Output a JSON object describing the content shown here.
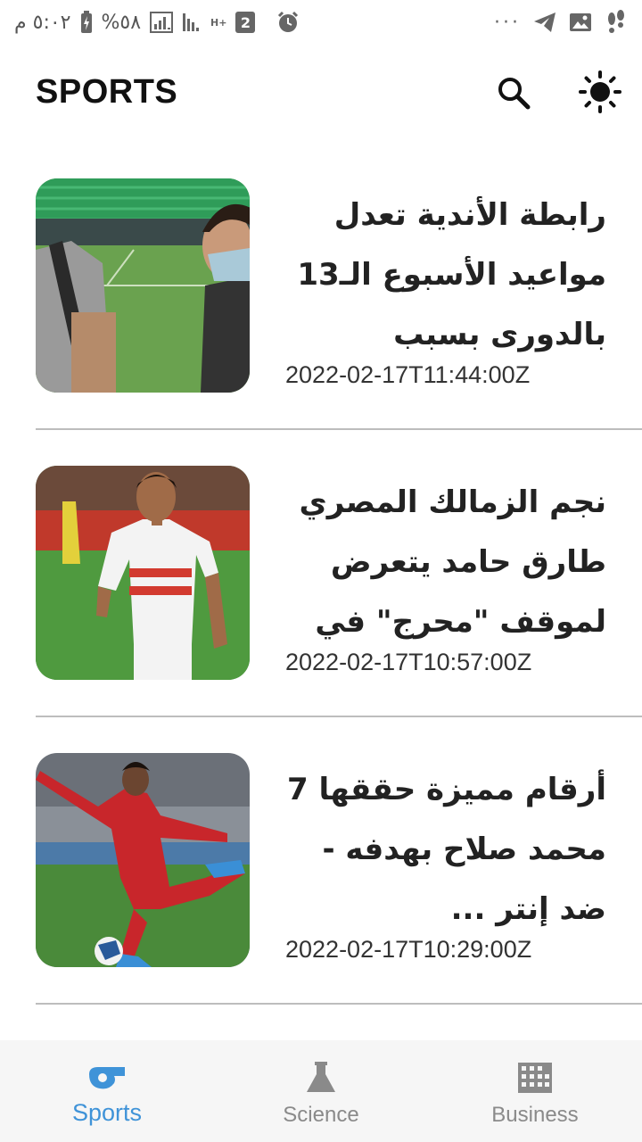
{
  "status_bar": {
    "time": "٥:٠٢ م",
    "battery": "%٥٨",
    "sim_slot": "2",
    "network": "H+",
    "more": "···"
  },
  "app_bar": {
    "title": "SPORTS",
    "search_icon": "search-icon",
    "theme_icon": "brightness-icon"
  },
  "articles": [
    {
      "headline": "رابطة الأندية تعدل مواعيد الأسبوع الـ13 بالدورى بسبب كيروش...",
      "date": "2022-02-17T11:44:00Z",
      "image": "player-with-mask-on-pitch"
    },
    {
      "headline": "نجم الزمالك المصري طارق حامد يتعرض لموقف \"محرج\" في ...",
      "date": "2022-02-17T10:57:00Z",
      "image": "zamalek-player-white-kit"
    },
    {
      "headline": "أرقام مميزة حققها 7 محمد صلاح بهدفه - ضد إنتر ...",
      "date": "2022-02-17T10:29:00Z",
      "image": "liverpool-player-kicking-ball"
    }
  ],
  "bottom_nav": {
    "items": [
      {
        "label": "Sports",
        "icon": "whistle-icon",
        "active": true
      },
      {
        "label": "Science",
        "icon": "flask-icon",
        "active": false
      },
      {
        "label": "Business",
        "icon": "building-icon",
        "active": false
      }
    ]
  },
  "colors": {
    "accent": "#3f93d8",
    "inactive": "#8a8a8a",
    "divider": "#bdbdbd",
    "nav_background": "#f6f6f6"
  }
}
